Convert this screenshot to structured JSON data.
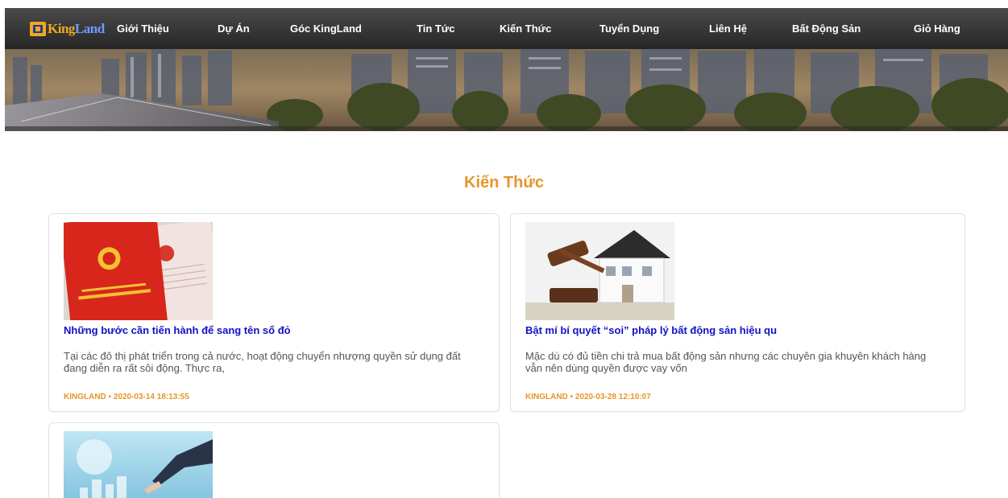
{
  "brand": {
    "logo_part1": "King",
    "logo_part2": "Land",
    "accent": "#e6952b",
    "link_color": "#1010c8"
  },
  "nav": {
    "items": [
      {
        "label": "Giới Thiệu"
      },
      {
        "label": "Dự Án"
      },
      {
        "label": "Góc KingLand"
      },
      {
        "label": "Tin Tức"
      },
      {
        "label": "Kiến Thức"
      },
      {
        "label": "Tuyển Dụng"
      },
      {
        "label": "Liên Hệ"
      },
      {
        "label": "Bất Động Sản"
      },
      {
        "label": "Giỏ Hàng"
      }
    ]
  },
  "page": {
    "title": "Kiến Thức"
  },
  "articles": [
    {
      "title": "Những bước cần tiến hành để sang tên sổ đỏ",
      "excerpt": "Tại các đô thị phát triển trong cả nước, hoạt động chuyển nhượng quyền sử dụng đất đang diễn ra rất sôi động. Thực ra,",
      "meta": "KINGLAND • 2020-03-14 18:13:55",
      "image": "red-land-certificate-image"
    },
    {
      "title": "Bật mí bí quyết “soi” pháp lý bất động sản hiệu qu",
      "excerpt": "Mặc dù có đủ tiền chi trả mua bất động sản nhưng các chuyên gia khuyên khách hàng vẫn nên dùng quyền được vay vốn",
      "meta": "KINGLAND • 2020-03-28 12:10:07",
      "image": "gavel-and-house-image"
    },
    {
      "title": "",
      "excerpt": "",
      "meta": "",
      "image": "digital-city-hand-image"
    }
  ]
}
